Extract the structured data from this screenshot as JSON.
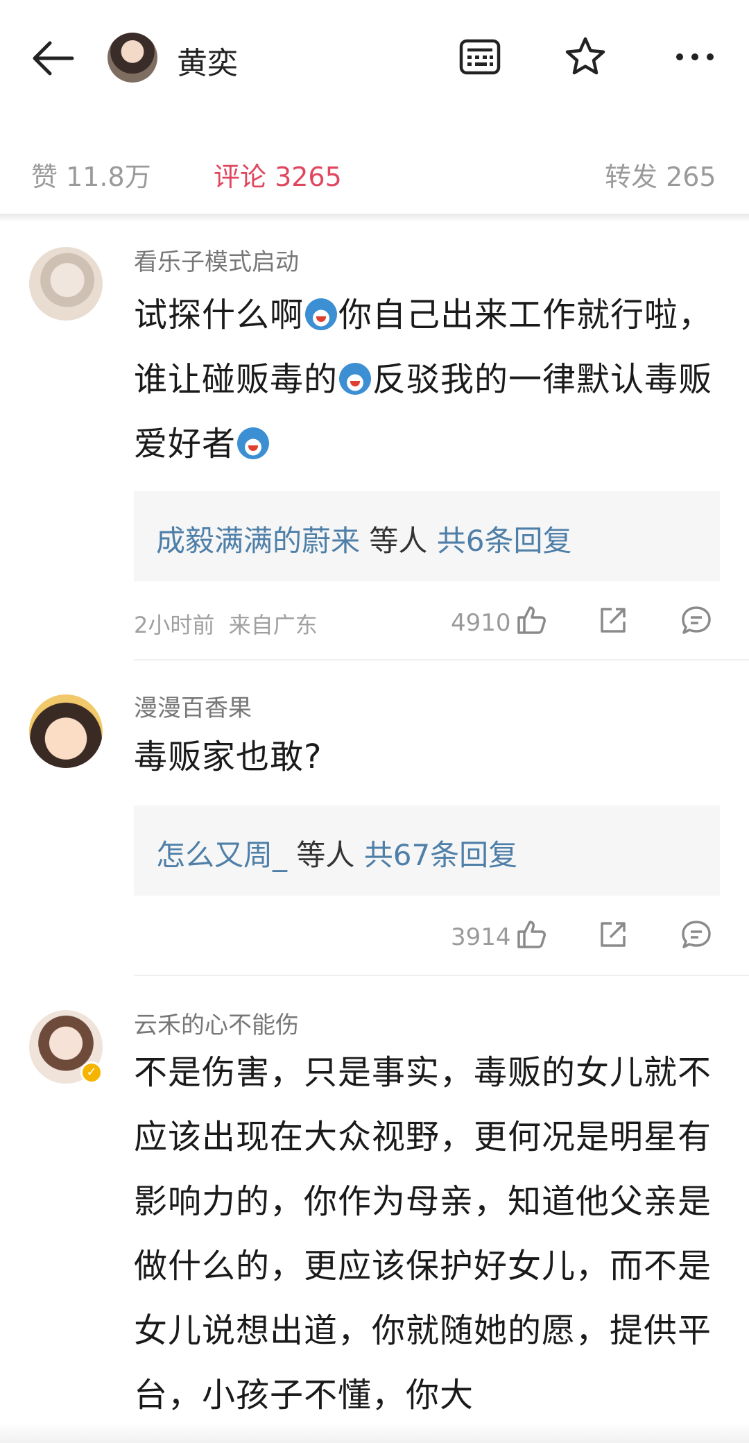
{
  "header": {
    "user_name": "黄奕",
    "icons": [
      "back-arrow-icon",
      "screenshot-list-icon",
      "star-icon",
      "more-icon"
    ]
  },
  "stats": {
    "likes_label": "赞 11.8万",
    "comments_label": "评论 3265",
    "reposts_label": "转发 265"
  },
  "comments": [
    {
      "user": "看乐子模式启动",
      "text_parts": [
        "试探什么啊",
        "你自己出来工作就行啦，谁让碰贩毒的",
        "反驳我的一律默认毒贩爱好者",
        ""
      ],
      "reply_user": "成毅满满的蔚来",
      "reply_mid": " 等人 ",
      "reply_count": "共6条回复",
      "time": "2小时前",
      "location": "来自广东",
      "likes": "4910"
    },
    {
      "user": "漫漫百香果",
      "text": "毒贩家也敢?",
      "reply_user": "怎么又周_",
      "reply_mid": " 等人 ",
      "reply_count": "共67条回复",
      "likes": "3914"
    },
    {
      "user": "云禾的心不能伤",
      "text": "不是伤害，只是事实，毒贩的女儿就不应该出现在大众视野，更何况是明星有影响力的，你作为母亲，知道他父亲是做什么的，更应该保护好女儿，而不是女儿说想出道，你就随她的愿，提供平台，小孩子不懂，你大"
    }
  ],
  "colors": {
    "accent": "#e0475f",
    "link": "#4e7fa8",
    "reply_bg": "#f6f6f6"
  }
}
